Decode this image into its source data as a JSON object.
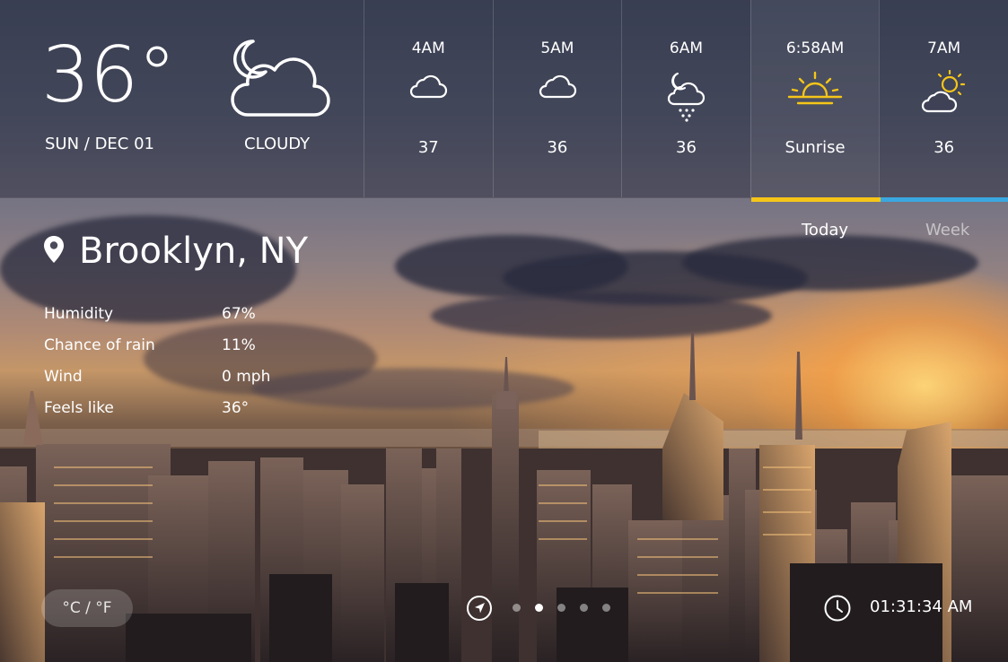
{
  "current": {
    "temperature": "36°",
    "date": "SUN / DEC 01",
    "condition": "CLOUDY",
    "condition_icon": "moon-cloud-icon"
  },
  "hourly": [
    {
      "time": "4AM",
      "value": "37",
      "icon": "cloud-icon"
    },
    {
      "time": "5AM",
      "value": "36",
      "icon": "cloud-icon"
    },
    {
      "time": "6AM",
      "value": "36",
      "icon": "moon-cloud-snow-icon"
    },
    {
      "time": "6:58AM",
      "value": "Sunrise",
      "icon": "sunrise-icon"
    },
    {
      "time": "7AM",
      "value": "36",
      "icon": "sun-cloud-icon"
    }
  ],
  "location": {
    "icon": "location-pin-icon",
    "name": "Brooklyn, NY"
  },
  "stats": [
    {
      "label": "Humidity",
      "value": "67%"
    },
    {
      "label": "Chance of rain",
      "value": "11%"
    },
    {
      "label": "Wind",
      "value": "0 mph"
    },
    {
      "label": "Feels like",
      "value": "36°"
    }
  ],
  "tabs": {
    "today": "Today",
    "week": "Week",
    "active": "today"
  },
  "footer": {
    "unit_toggle": "°C / °F",
    "page_dots": 5,
    "active_dot": 2,
    "time": "01:31:34 AM"
  },
  "colors": {
    "sunrise_bar": "#f5c518",
    "next_bar": "#3aa7e0",
    "sun_icon": "#f5c518"
  }
}
